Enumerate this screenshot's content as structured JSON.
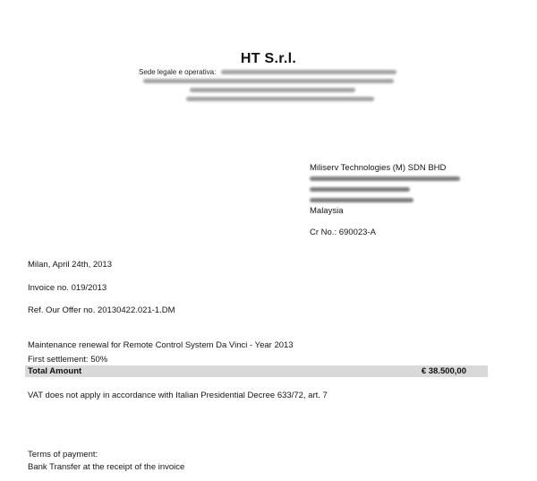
{
  "letterhead": {
    "company_name": "HT S.r.l.",
    "office_label": "Sede legale e operativa:"
  },
  "recipient": {
    "name": "Miliserv Technologies (M) SDN BHD",
    "country": "Malaysia",
    "cr_no": "Cr No.: 690023-A"
  },
  "letter": {
    "date_line": "Milan, April 24th, 2013",
    "invoice_no": "Invoice no. 019/2013",
    "reference": "Ref. Our Offer no. 20130422.021-1.DM",
    "description": "Maintenance renewal for Remote Control System Da Vinci - Year 2013",
    "settlement": "First settlement: 50%",
    "total_label": "Total Amount",
    "total_value": "€ 38.500,00",
    "vat_note": "VAT does not apply in accordance with Italian Presidential Decree 633/72, art. 7",
    "terms_heading": "Terms of payment:",
    "terms_text": "Bank Transfer at the receipt of the invoice"
  },
  "colors": {
    "text": "#151515",
    "total_bar": "#d9d9d9",
    "redaction": "#9a9a9a"
  }
}
